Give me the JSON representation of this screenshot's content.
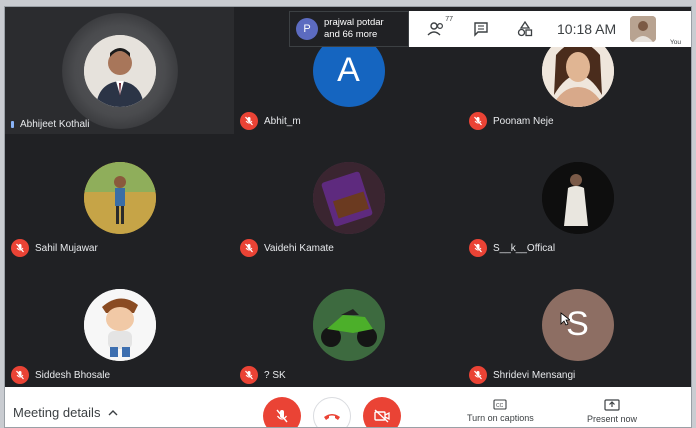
{
  "presenter": {
    "initial": "P",
    "name": "prajwal potdar",
    "others": "and 66 more"
  },
  "topbar": {
    "participants_count": "77",
    "time": "10:18 AM",
    "self_label": "You"
  },
  "tiles": [
    {
      "name": "Abhijeet Kothali",
      "initial": "",
      "muted": false,
      "speaking": true,
      "avatar_color": "#d8d3cc"
    },
    {
      "name": "Abhit_m",
      "initial": "A",
      "muted": true,
      "speaking": false,
      "avatar_color": "#1565c0"
    },
    {
      "name": "Poonam Neje",
      "initial": "",
      "muted": true,
      "speaking": false,
      "avatar_color": "#e9dcd0"
    },
    {
      "name": "Sahil Mujawar",
      "initial": "",
      "muted": true,
      "speaking": false,
      "avatar_color": "#b59a3c"
    },
    {
      "name": "Vaidehi Kamate",
      "initial": "",
      "muted": true,
      "speaking": false,
      "avatar_color": "#5b3a55"
    },
    {
      "name": "S__k__Offical",
      "initial": "",
      "muted": true,
      "speaking": false,
      "avatar_color": "#111111"
    },
    {
      "name": "Siddesh Bhosale",
      "initial": "",
      "muted": true,
      "speaking": false,
      "avatar_color": "#f2f2f2"
    },
    {
      "name": "? SK",
      "initial": "",
      "muted": true,
      "speaking": false,
      "avatar_color": "#2f5130"
    },
    {
      "name": "Shridevi Mensangi",
      "initial": "S",
      "muted": true,
      "speaking": false,
      "avatar_color": "#8d6e63"
    }
  ],
  "bottombar": {
    "meeting_details": "Meeting details",
    "captions_label": "Turn on captions",
    "present_label": "Present now"
  },
  "icons": {
    "participants": "people-icon",
    "chat": "chat-icon",
    "activities": "shapes-icon",
    "mic": "mic-off-icon",
    "hangup": "phone-hangup-icon",
    "camera": "camera-off-icon",
    "captions": "cc-icon",
    "present": "present-icon"
  },
  "colors": {
    "background": "#202124",
    "muted_red": "#ea4335",
    "speaking_blue": "#8ab4f8"
  }
}
